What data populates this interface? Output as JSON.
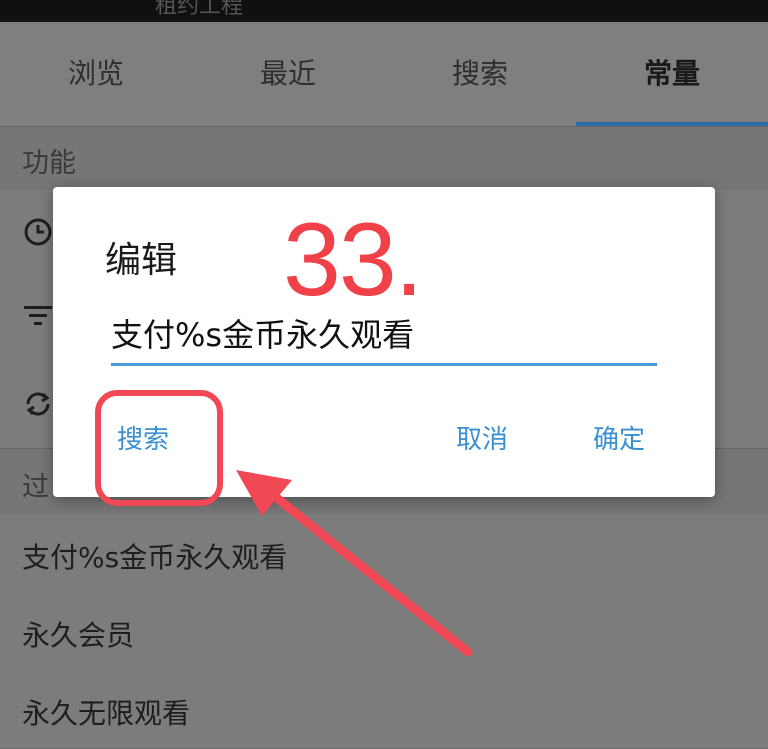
{
  "statusbar": {
    "text": "租约工程"
  },
  "tabs": [
    {
      "label": "浏览",
      "active": false
    },
    {
      "label": "最近",
      "active": false
    },
    {
      "label": "搜索",
      "active": false
    },
    {
      "label": "常量",
      "active": true
    }
  ],
  "sections": {
    "functions_header": "功能",
    "filter_header": "过"
  },
  "function_icons": [
    "clock-icon",
    "filter-icon",
    "refresh-icon"
  ],
  "list_items": [
    "支付%s金币永久观看",
    "永久会员",
    "永久无限观看"
  ],
  "dialog": {
    "title": "编辑",
    "input_value": "支付%s金币永久观看",
    "search_button": "搜索",
    "cancel_button": "取消",
    "confirm_button": "确定"
  },
  "annotation": {
    "step_number": "33.",
    "color": "#f04048"
  },
  "colors": {
    "accent": "#3a8fd0",
    "tab_indicator": "#2d6fa8",
    "annotation_red": "#f04854"
  }
}
